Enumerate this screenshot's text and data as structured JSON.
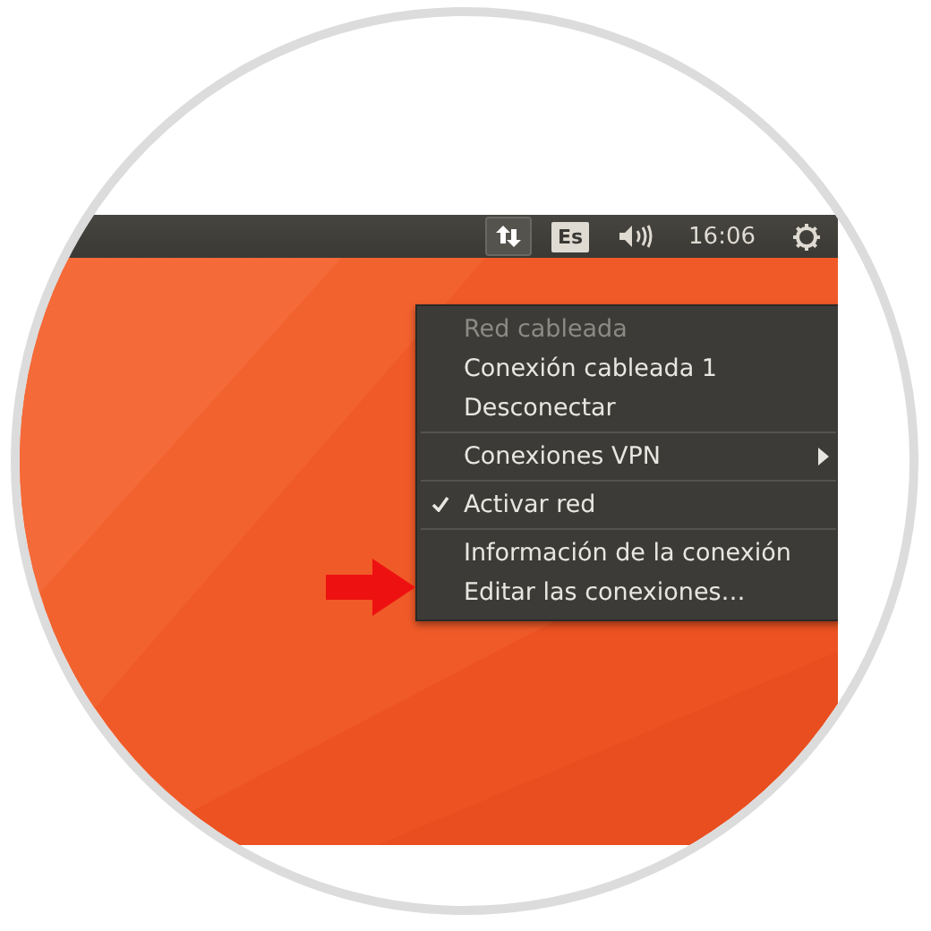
{
  "top_panel": {
    "indicators": [
      {
        "kind": "network",
        "selected": true
      },
      {
        "kind": "keyboard",
        "label": "Es",
        "selected": false
      },
      {
        "kind": "volume",
        "selected": false
      },
      {
        "kind": "clock",
        "label": "16:06",
        "selected": false
      },
      {
        "kind": "power",
        "selected": false
      }
    ]
  },
  "network_menu": {
    "sections": [
      [
        {
          "label": "Red cableada",
          "disabled": true,
          "checked": false,
          "submenu": false
        },
        {
          "label": "Conexión cableada 1",
          "disabled": false,
          "checked": false,
          "submenu": false
        },
        {
          "label": "Desconectar",
          "disabled": false,
          "checked": false,
          "submenu": false
        }
      ],
      [
        {
          "label": "Conexiones VPN",
          "disabled": false,
          "checked": false,
          "submenu": true
        }
      ],
      [
        {
          "label": "Activar red",
          "disabled": false,
          "checked": true,
          "submenu": false
        }
      ],
      [
        {
          "label": "Información de la conexión",
          "disabled": false,
          "checked": false,
          "submenu": false
        },
        {
          "label": "Editar las conexiones…",
          "disabled": false,
          "checked": false,
          "submenu": false
        }
      ]
    ]
  }
}
